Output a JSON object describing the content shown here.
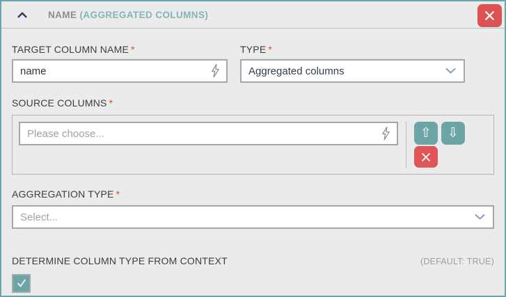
{
  "panel": {
    "title": "NAME",
    "subtitle": "(AGGREGATED COLUMNS)"
  },
  "header": {
    "collapse_icon": "chevron-up",
    "close_icon": "x"
  },
  "fields": {
    "target_column_name": {
      "label": "TARGET COLUMN NAME",
      "required": "*",
      "value": "name",
      "icon": "lightning-bolt"
    },
    "type": {
      "label": "TYPE",
      "required": "*",
      "value": "Aggregated columns",
      "icon": "chevron-down"
    },
    "source_columns": {
      "label": "SOURCE COLUMNS",
      "required": "*",
      "placeholder": "Please choose...",
      "icon": "lightning-bolt",
      "buttons": {
        "move_up_glyph": "⇧",
        "move_down_glyph": "⇩",
        "remove_icon": "x"
      }
    },
    "aggregation_type": {
      "label": "AGGREGATION TYPE",
      "required": "*",
      "placeholder": "Select...",
      "icon": "chevron-down"
    },
    "determine_column_type": {
      "label": "DETERMINE COLUMN TYPE FROM CONTEXT",
      "default_note": "(DEFAULT: TRUE)",
      "checked": true,
      "check_glyph": "checkmark"
    }
  },
  "colors": {
    "panel_border": "#68a6a9",
    "teal_button": "#6ba5a6",
    "red_button": "#e05555",
    "header_title_gray": "#8d8d8d",
    "header_title_teal": "#85b4b7",
    "required_red": "#e0472e",
    "select_text": "#333c4e",
    "placeholder_gray": "#a3a3a3"
  }
}
